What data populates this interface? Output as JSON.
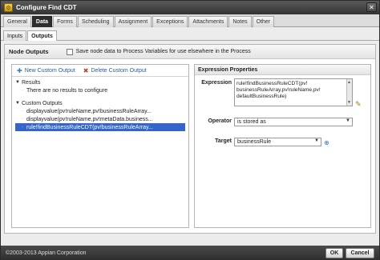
{
  "window": {
    "title": "Configure Find CDT"
  },
  "tabs": [
    "General",
    "Data",
    "Forms",
    "Scheduling",
    "Assignment",
    "Exceptions",
    "Attachments",
    "Notes",
    "Other"
  ],
  "active_tab": "Data",
  "subtabs": [
    "Inputs",
    "Outputs"
  ],
  "active_subtab": "Outputs",
  "node_outputs": {
    "title": "Node Outputs",
    "save_option": "Save node data to Process Variables for use elsewhere in the Process"
  },
  "toolbar": {
    "new_label": "New Custom Output",
    "delete_label": "Delete Custom Output"
  },
  "tree": {
    "results_label": "Results",
    "results_empty": "There are no results to configure",
    "custom_label": "Custom Outputs",
    "custom_items": [
      "displayvalue(pv!ruleName,pv!businessRuleArray...",
      "displayvalue(pv!ruleName,pv!metaData.business...",
      "rule!findBusinessRuleCDT(pv!businessRuleArray..."
    ],
    "selected_index": 2
  },
  "expression": {
    "title": "Expression Properties",
    "expression_label": "Expression",
    "expression_lines": [
      "rule!findBusinessRuleCDT(pv!",
      "businessRuleArray,pv!ruleName,pv!",
      "defaultBusinessRule)"
    ],
    "operator_label": "Operator",
    "operator_value": "is stored as",
    "target_label": "Target",
    "target_value": "businessRule"
  },
  "footer": {
    "copyright": "©2003-2013 Appian Corporation",
    "ok_label": "OK",
    "cancel_label": "Cancel"
  }
}
